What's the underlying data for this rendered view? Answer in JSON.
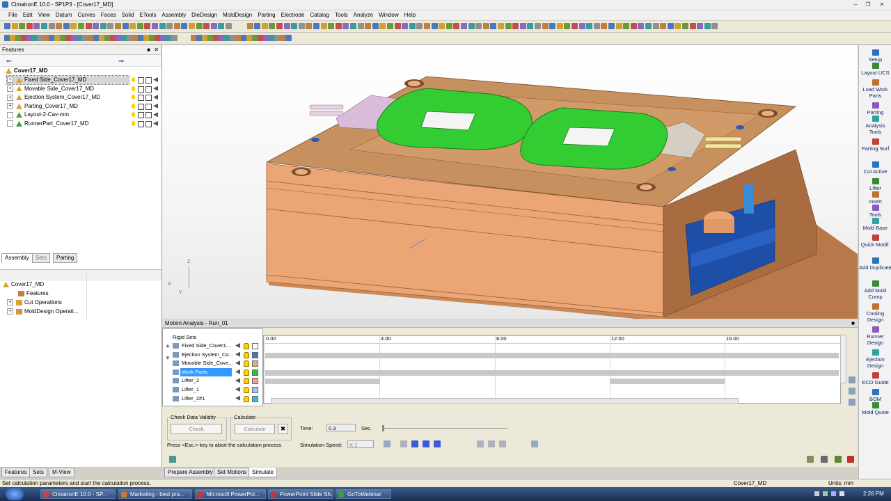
{
  "window": {
    "title": "CimatronE 10.0 - SP1P3 - [Cover17_MD]"
  },
  "menu": [
    "File",
    "Edit",
    "View",
    "Datum",
    "Curves",
    "Faces",
    "Solid",
    "ETools",
    "Assembly",
    "DieDesign",
    "MoldDesign",
    "Parting",
    "Electrode",
    "Catalog",
    "Tools",
    "Analyze",
    "Window",
    "Help"
  ],
  "features_panel": {
    "title": "Features",
    "root": "Cover17_MD",
    "items": [
      {
        "label": "Fixed Side_Cover17_MD",
        "selected": true
      },
      {
        "label": "Movable Side_Cover17_MD"
      },
      {
        "label": "Ejection System_Cover17_MD"
      },
      {
        "label": "Parting_Cover17_MD"
      },
      {
        "label": "Layout-2-Cav-mm"
      },
      {
        "label": "RunnerPart_Cover17_MD"
      }
    ],
    "tabs": [
      "Assembly",
      "Sets",
      "Parting"
    ]
  },
  "lower_tree": {
    "root": "Cover17_MD",
    "items": [
      "Features",
      "Cut Operations",
      "MoldDesign Operati..."
    ]
  },
  "axes": {
    "z": "Z",
    "x": "X",
    "y": "Y"
  },
  "motion_analysis": {
    "title": "Motion Analysis - Run_01",
    "rigid_sets_header": "Rigid Sets",
    "rows": [
      {
        "label": "Fixed Side_Cover1...",
        "color": "#ffffff"
      },
      {
        "label": "Ejection System_Co...",
        "color": "#2e7de0"
      },
      {
        "label": "Movable Side_Cove...",
        "color": "#e8a878"
      },
      {
        "label": "Work Parts",
        "color": "#2ec02e",
        "selected": true
      },
      {
        "label": "Lifter_2",
        "color": "#f0a0a0"
      },
      {
        "label": "Lifter_1",
        "color": "#a0c8f0"
      },
      {
        "label": "Lifter_2#1",
        "color": "#30c8c0"
      }
    ],
    "timeline_ticks": [
      "0.00",
      "4.00",
      "8.00",
      "12.00",
      "16.00"
    ],
    "check_group": "Check Data Validity",
    "check_button": "Check",
    "calc_group": "Calculate",
    "calc_button": "Calculate",
    "abort_hint": "Press <Esc.> key to abort the calculation process",
    "time_label": "Time:",
    "time_value": "0.3",
    "time_unit": "Sec.",
    "speed_label": "Simulation Speed:",
    "speed_value": "X 1",
    "slider_position": 0.0
  },
  "right_tools": [
    "Setup",
    "Layout UCS",
    "Load Work Parts",
    "Parting",
    "Analysis Tools",
    "Parting Surf",
    "Cut Active",
    "Lifter",
    "Insert",
    "Tools",
    "Mold Base",
    "Quick Modif.",
    "Add Duplicate",
    "Add Mold Comp",
    "Cooling Design",
    "Runner Design",
    "Ejection Design",
    "ECO Guide",
    "BOM",
    "Mold Quote"
  ],
  "bottom_left_tabs": [
    "Features",
    "Sets",
    "M-View"
  ],
  "bottom_motion_tabs": [
    "Prepare Assembly",
    "Set Motions",
    "Simulate"
  ],
  "status": {
    "message": "Set calculation parameters and start the calculation process.",
    "model": "Cover17_MD",
    "units": "Units: mm"
  },
  "taskbar": {
    "items": [
      "CimatronE 10.0 - SP...",
      "Marketing - best pra...",
      "Microsoft PowerPoi...",
      "PowerPoint Slide Sh...",
      "GoToWebinar"
    ],
    "clock": "2:26 PM"
  },
  "colors": {
    "mold_plate": "#e9a877",
    "mold_dark": "#b8784a",
    "part_green": "#33cc33",
    "accent_blue": "#1e4fa8",
    "selection": "#3399ff"
  }
}
